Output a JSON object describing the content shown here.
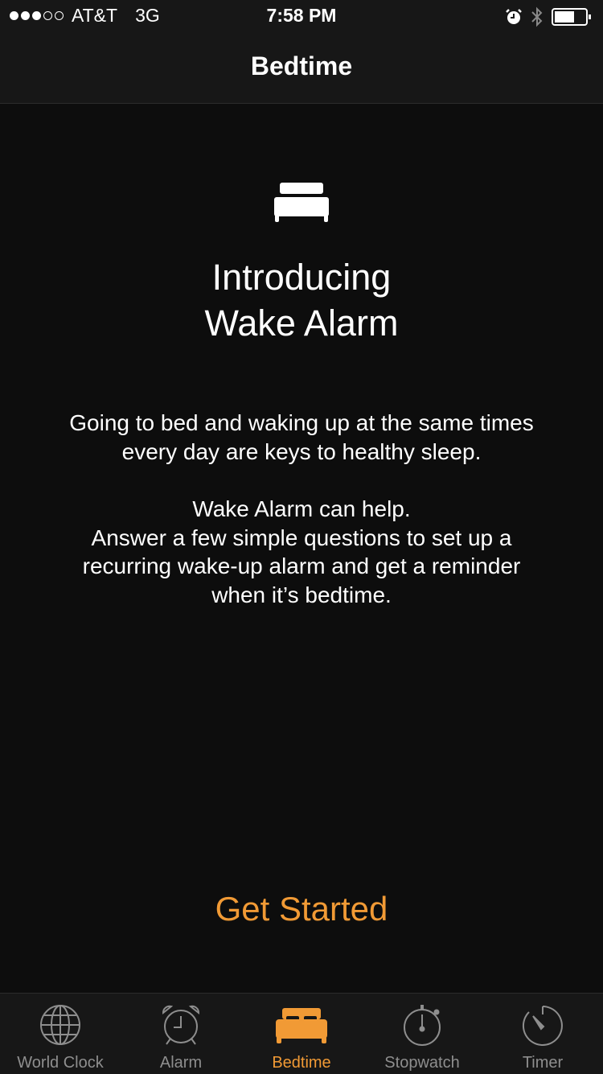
{
  "status_bar": {
    "signal_filled": 3,
    "signal_total": 5,
    "carrier": "AT&T",
    "network": "3G",
    "time": "7:58 PM",
    "icons": [
      "alarm-icon",
      "bluetooth-icon",
      "battery-icon"
    ],
    "battery_level": 0.6
  },
  "nav": {
    "title": "Bedtime"
  },
  "main": {
    "hero_icon": "bed-icon",
    "headline_line1": "Introducing",
    "headline_line2": "Wake Alarm",
    "paragraph1": "Going to bed and waking up at the same times every day are keys to healthy sleep.",
    "paragraph2_line1": "Wake Alarm can help.",
    "paragraph2_line2": "Answer a few simple questions to set up a recurring wake-up alarm and get a reminder when it’s bedtime.",
    "cta_label": "Get Started"
  },
  "tabbar": {
    "active_index": 2,
    "accent_color": "#f19a35",
    "inactive_color": "#8e8e8e",
    "tabs": [
      {
        "label": "World Clock",
        "icon": "globe-icon"
      },
      {
        "label": "Alarm",
        "icon": "alarm-clock-icon"
      },
      {
        "label": "Bedtime",
        "icon": "bed-icon"
      },
      {
        "label": "Stopwatch",
        "icon": "stopwatch-icon"
      },
      {
        "label": "Timer",
        "icon": "timer-icon"
      }
    ]
  }
}
